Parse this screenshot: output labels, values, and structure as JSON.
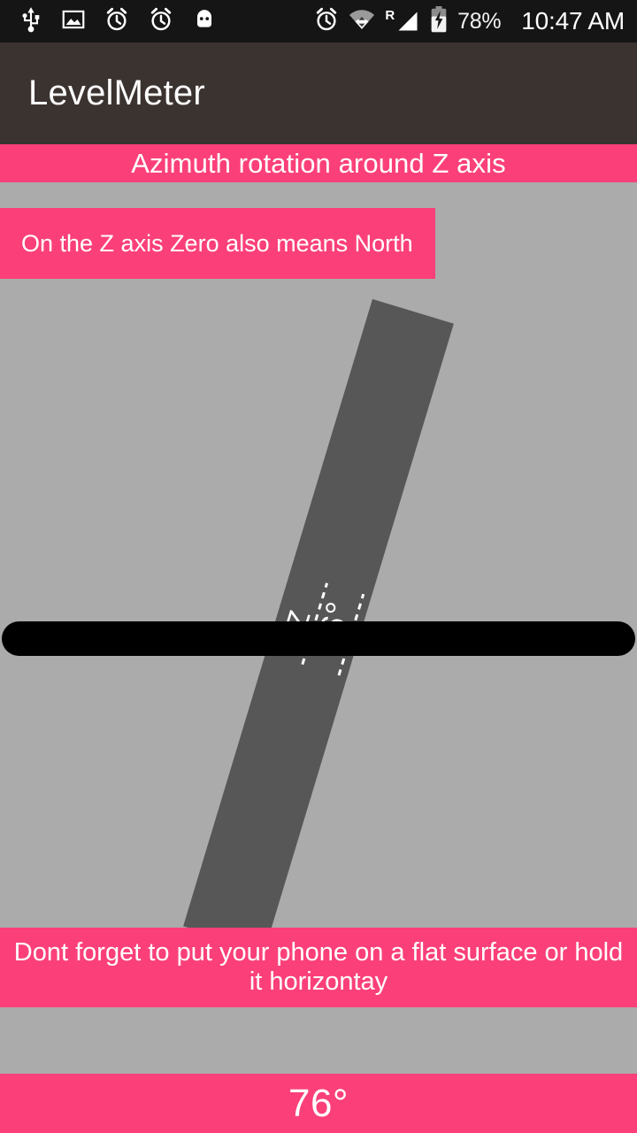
{
  "status_bar": {
    "left_icons": [
      "usb-icon",
      "image-icon",
      "alarm-clock-icon",
      "alarm-clock-icon",
      "android-head-icon"
    ],
    "right_icons": [
      "alarm-clock-icon",
      "wifi-icon",
      "roaming-signal-icon",
      "battery-charging-icon"
    ],
    "roaming_label": "R",
    "battery_percent": "78%",
    "clock": "10:47 AM"
  },
  "action_bar": {
    "app_title": "LevelMeter"
  },
  "banners": {
    "header": "Azimuth rotation around Z axis",
    "note": "On the Z axis Zero also means North",
    "tip": "Dont forget to put your phone on a flat surface or hold it horizontay",
    "value": "76°"
  },
  "gauge": {
    "axis_label": "Z",
    "angle_label": "76°",
    "rotation_degrees": 16.8
  },
  "colors": {
    "accent_pink": "#fb4079",
    "background_gray": "#ababab",
    "needle_gray": "#575757",
    "action_bar": "#3b3330",
    "status_bar": "#151515",
    "level_bar": "#000000"
  }
}
